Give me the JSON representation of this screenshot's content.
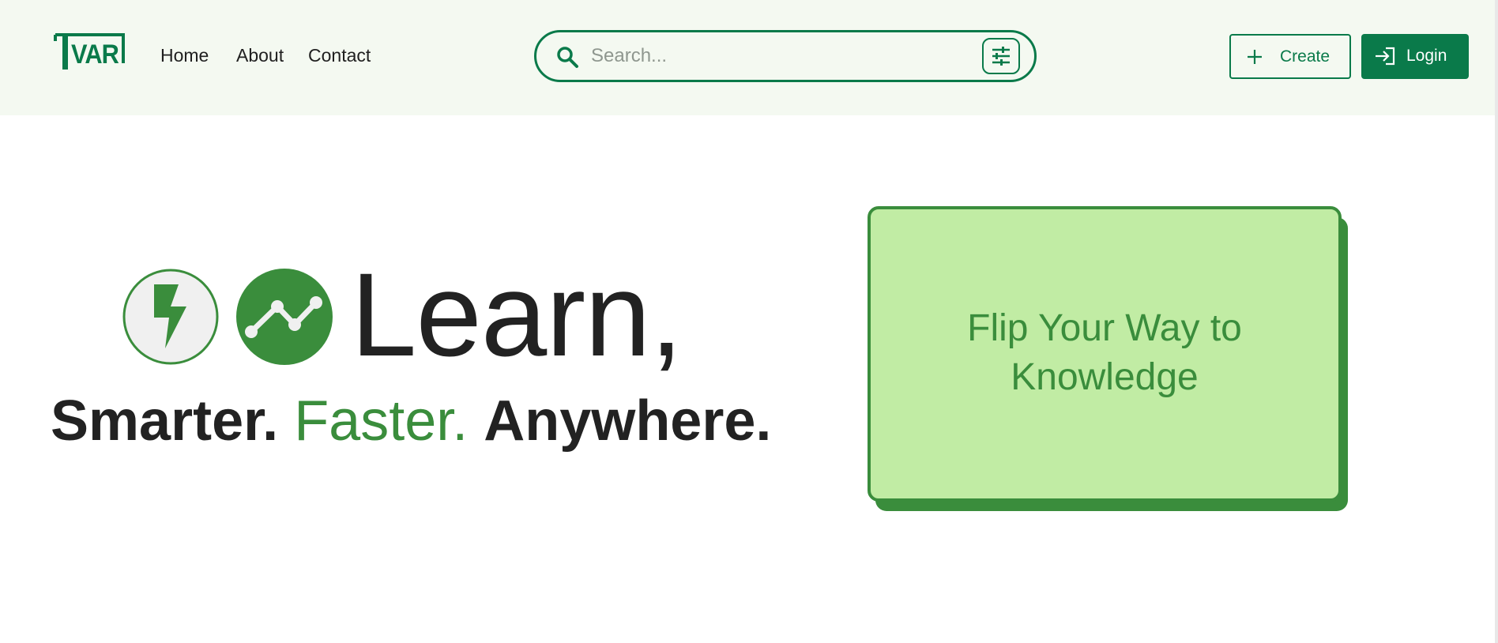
{
  "brand": {
    "logo_text": "TVAR",
    "accent_color": "#0a7a4a",
    "hero_green": "#3a8d3c",
    "card_fill": "#c1eca4",
    "header_bg": "#f4f9f1"
  },
  "nav": {
    "items": [
      {
        "label": "Home"
      },
      {
        "label": "About"
      },
      {
        "label": "Contact"
      }
    ]
  },
  "search": {
    "placeholder": "Search...",
    "value": "",
    "icon": "search-icon",
    "filter_icon": "sliders-icon"
  },
  "actions": {
    "create_label": "Create",
    "create_icon": "plus-icon",
    "login_label": "Login",
    "login_icon": "login-icon"
  },
  "hero": {
    "icons": [
      "lightning-icon",
      "trending-line-icon"
    ],
    "heading": "Learn,",
    "tagline_part1": "Smarter.",
    "tagline_part2": "Faster.",
    "tagline_part3": "Anywhere."
  },
  "card": {
    "text_line1": "Flip Your Way to",
    "text_line2": "Knowledge"
  }
}
